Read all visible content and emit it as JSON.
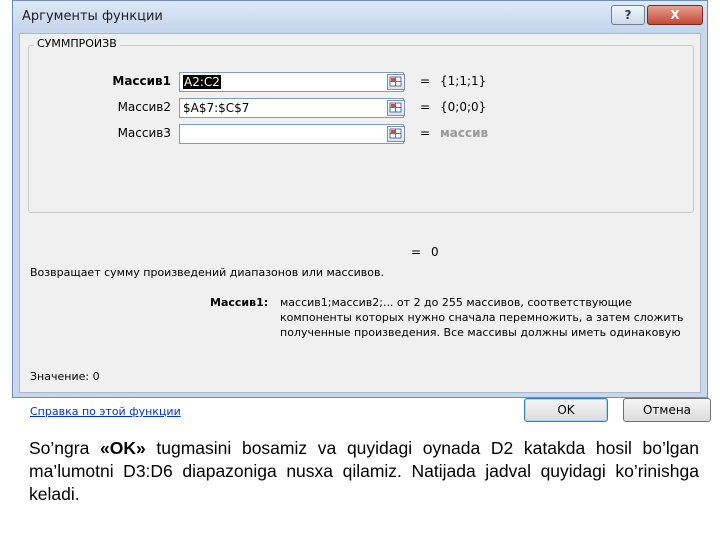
{
  "dialog": {
    "title": "Аргументы функции",
    "help_button": "?",
    "close_button": "X",
    "function_name": "СУММПРОИЗВ",
    "args": [
      {
        "label": "Массив1",
        "value": "A2:C2",
        "result": "{1;1;1}",
        "selected": true
      },
      {
        "label": "Массив2",
        "value": "$A$7:$C$7",
        "result": "{0;0;0}",
        "selected": false
      },
      {
        "label": "Массив3",
        "value": "",
        "result": "массив",
        "selected": false
      }
    ],
    "eq_sign": "=",
    "result_value": "0",
    "description": "Возвращает сумму произведений диапазонов или массивов.",
    "arg_desc_label": "Массив1:",
    "arg_desc_text": "массив1;массив2;... от 2 до 255 массивов, соответствующие компоненты которых нужно сначала перемножить, а затем сложить полученные произведения. Все массивы должны иметь одинаковую",
    "value_label": "Значение:  0",
    "help_link": "Справка по этой функции",
    "ok_button": "OK",
    "cancel_button": "Отмена"
  },
  "caption": {
    "before": "So’ngra ",
    "bold": "«OK»",
    "after": " tugmasini bosamiz va quyidagi oynada   D2  katakda hosil bo’lgan ma’lumotni D3:D6 diapazoniga nusxa qilamiz. Natijada jadval quyidagi ko’rinishga keladi."
  },
  "colors": {
    "window_frame": "#c7d7ec",
    "link": "#0033cc",
    "close_button": "#c24a36"
  }
}
